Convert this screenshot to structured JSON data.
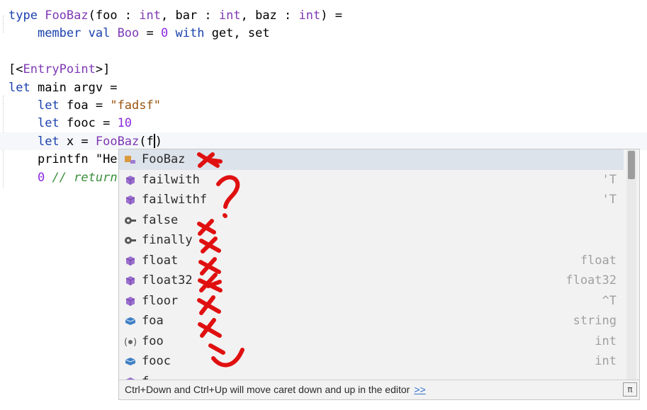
{
  "code": {
    "l1": {
      "kw": "type",
      "name": "FooBaz",
      "open": "(foo : ",
      "t1": "int",
      "mid1": ", bar : ",
      "t2": "int",
      "mid2": ", baz : ",
      "t3": "int",
      "close": ") ="
    },
    "l2": {
      "kw": "member val",
      "name": "Boo",
      "eq": " = ",
      "num": "0",
      "kw2": "with",
      "rest": " get, set"
    },
    "l4": {
      "attr_open": "[<",
      "attr": "EntryPoint",
      "attr_close": ">]"
    },
    "l5": {
      "kw": "let",
      "rest": " main argv ="
    },
    "l6": {
      "kw": "let",
      "mid": " foa = ",
      "str": "\"fadsf\""
    },
    "l7": {
      "kw": "let",
      "mid": " fooc = ",
      "num": "10"
    },
    "l8": {
      "kw": "let",
      "mid": " x = ",
      "type": "FooBaz",
      "paren": "(f",
      "after": ")"
    },
    "l9": {
      "text": "printfn \"Hel"
    },
    "l10": {
      "num": "0",
      "comment": " // return"
    }
  },
  "completion": {
    "items": [
      {
        "name": "FooBaz",
        "type": "",
        "icon": "type-icon"
      },
      {
        "name": "failwith",
        "type": "'T",
        "icon": "function-icon"
      },
      {
        "name": "failwithf",
        "type": "'T",
        "icon": "function-icon"
      },
      {
        "name": "false",
        "type": "",
        "icon": "keyword-icon"
      },
      {
        "name": "finally",
        "type": "",
        "icon": "keyword-icon"
      },
      {
        "name": "float",
        "type": "float",
        "icon": "function-icon"
      },
      {
        "name": "float32",
        "type": "float32",
        "icon": "function-icon"
      },
      {
        "name": "floor",
        "type": "^T",
        "icon": "function-icon"
      },
      {
        "name": "foa",
        "type": "string",
        "icon": "value-icon"
      },
      {
        "name": "foo",
        "type": "int",
        "icon": "parameter-icon"
      },
      {
        "name": "fooc",
        "type": "int",
        "icon": "value-icon"
      },
      {
        "name": "f",
        "type": "",
        "icon": "function-icon"
      }
    ],
    "footer": "Ctrl+Down and Ctrl+Up will move caret down and up in the editor",
    "footer_link": ">>",
    "pin": "π"
  },
  "colors": {
    "keyword": "#1a41ad",
    "type": "#7e38b4",
    "string": "#9b5410",
    "comment": "#3b8f3b",
    "annotation": "#e01010",
    "selection": "#dde3ea"
  }
}
